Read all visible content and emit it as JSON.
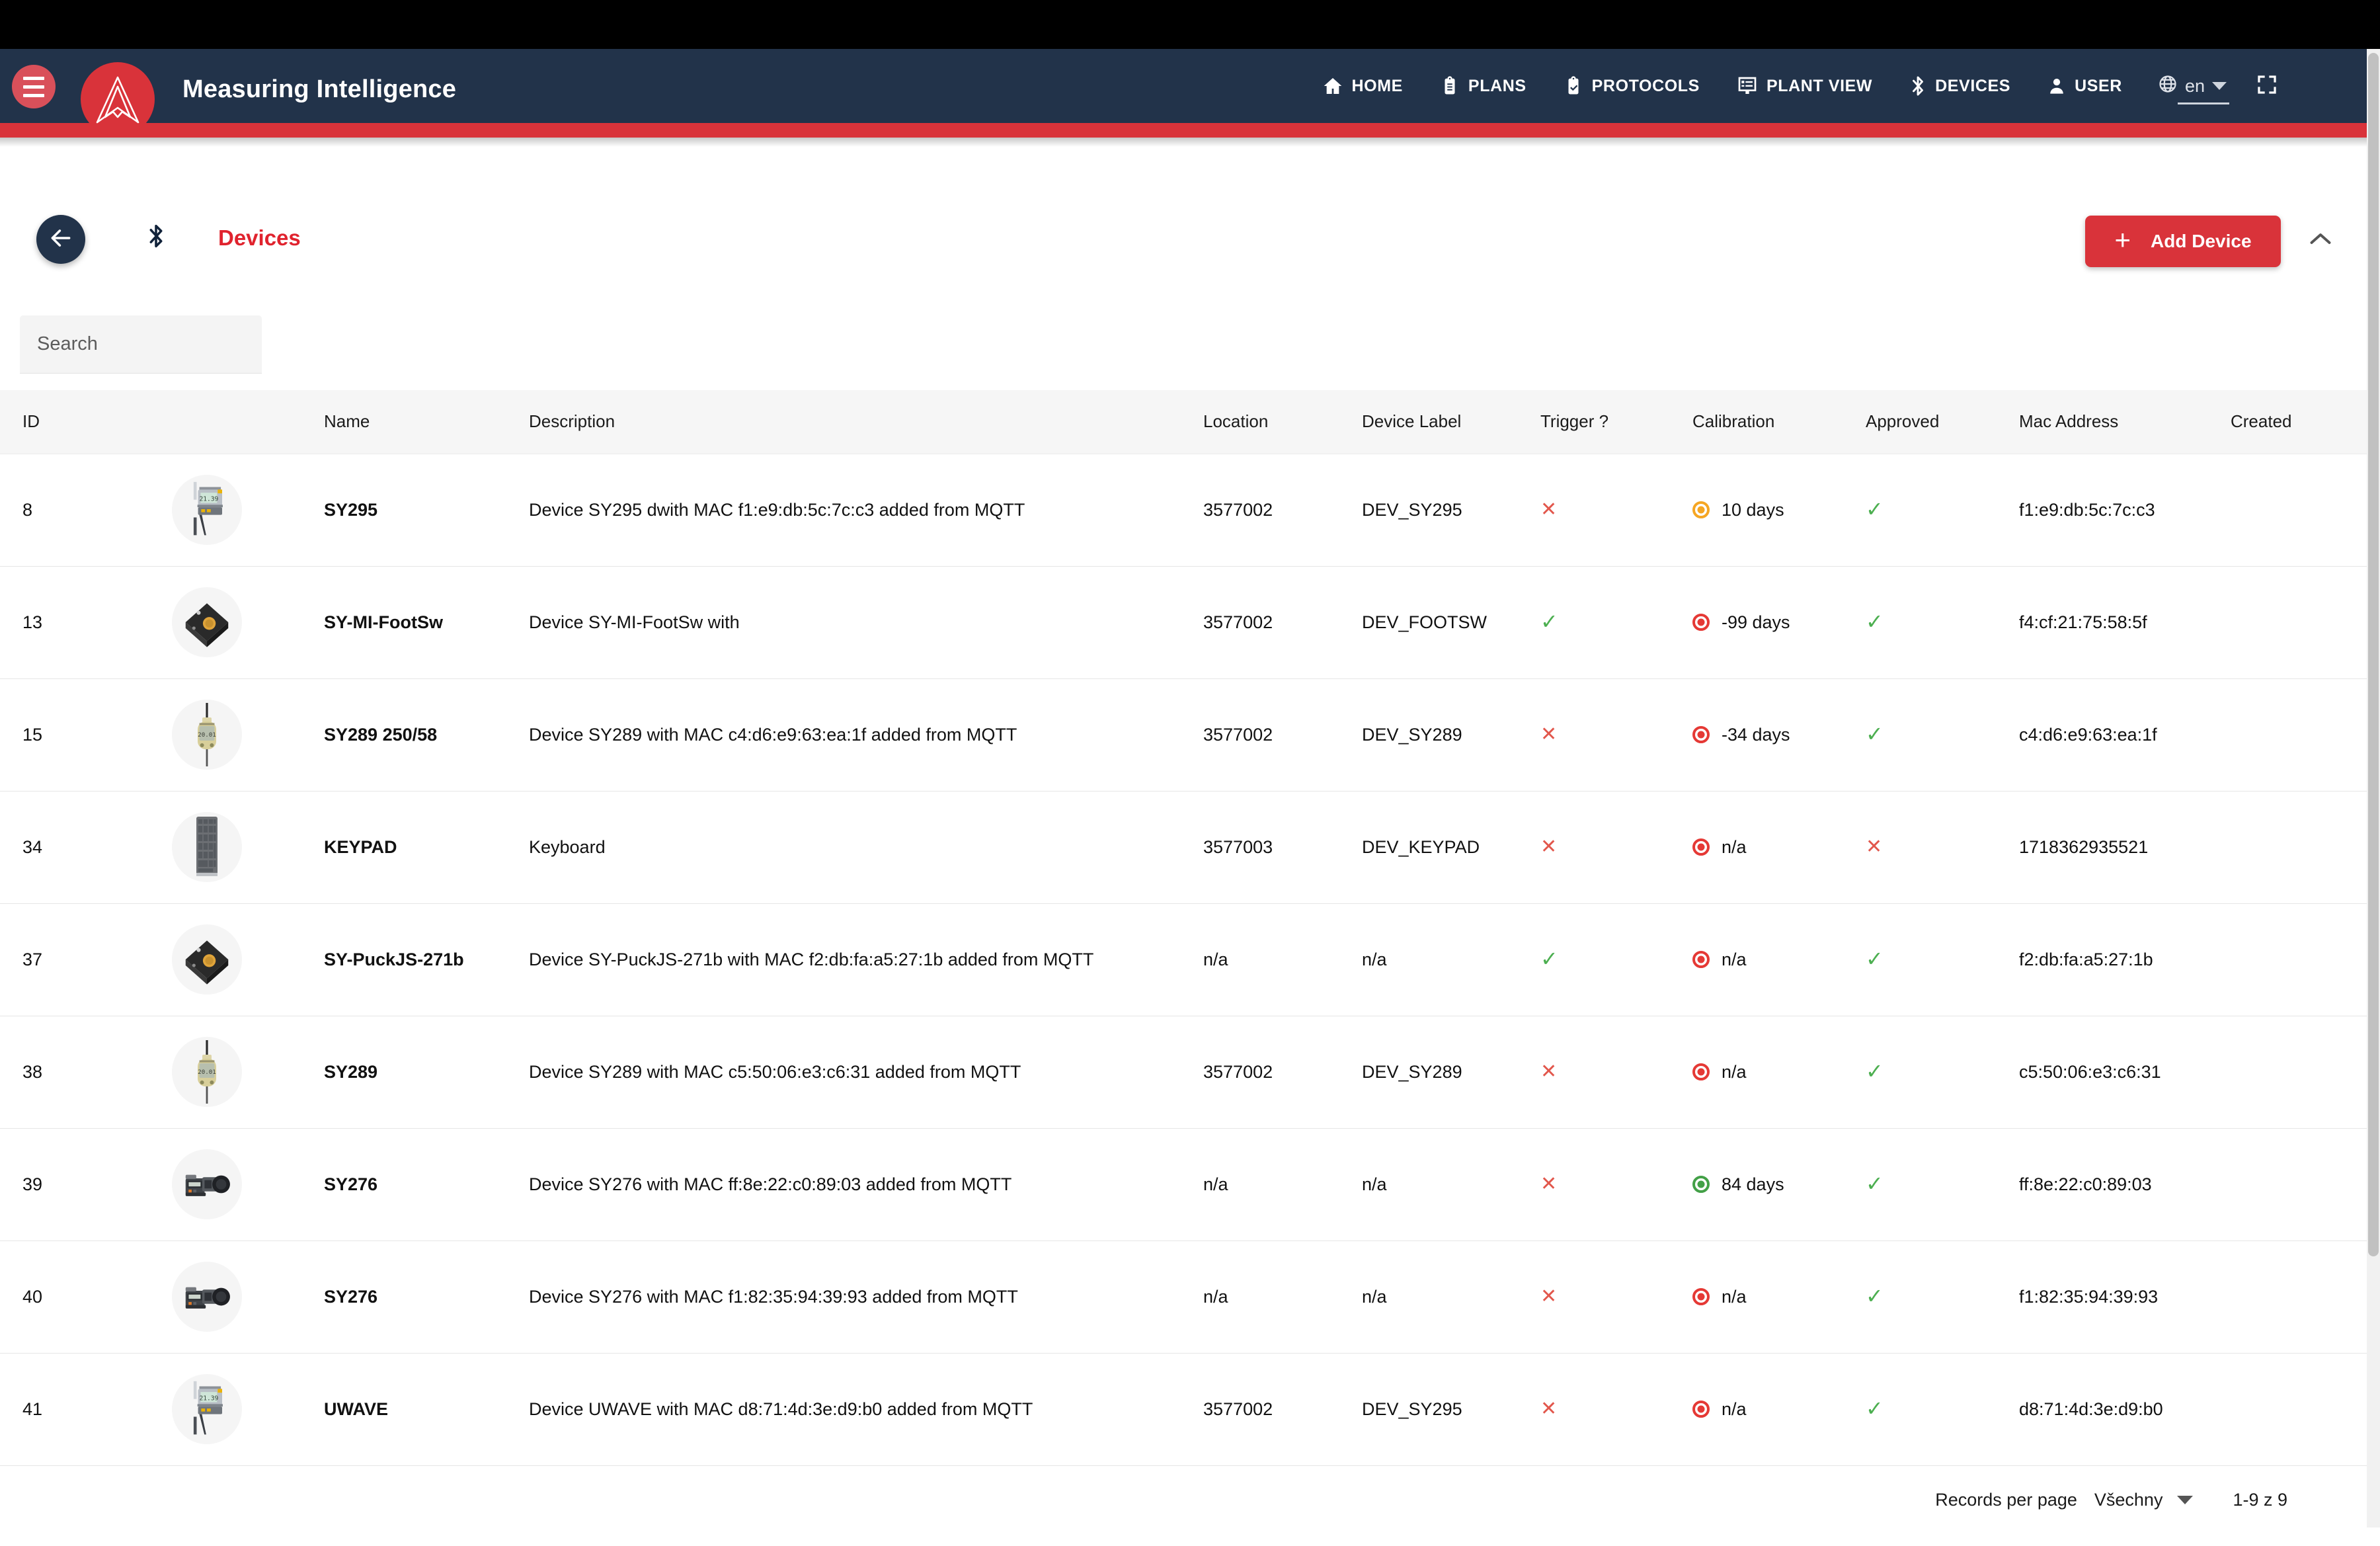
{
  "brand": {
    "title": "Measuring Intelligence",
    "logo_icon": "mountain-peak-logo",
    "menu_icon": "hamburger-menu-icon"
  },
  "nav": {
    "items": [
      {
        "label": "HOME",
        "icon": "home-icon"
      },
      {
        "label": "PLANS",
        "icon": "clipboard-icon"
      },
      {
        "label": "PROTOCOLS",
        "icon": "clipboard-check-icon"
      },
      {
        "label": "PLANT VIEW",
        "icon": "list-panel-icon"
      },
      {
        "label": "DEVICES",
        "icon": "bluetooth-icon"
      },
      {
        "label": "USER",
        "icon": "person-icon"
      }
    ],
    "language": {
      "value": "en",
      "icon": "globe-icon",
      "caret": "chevron-down-icon"
    },
    "fullscreen_icon": "fullscreen-icon"
  },
  "toolbar": {
    "back_icon": "arrow-left-icon",
    "bluetooth_icon": "bluetooth-icon",
    "title": "Devices",
    "add_button": {
      "label": "Add Device",
      "plus": "+",
      "color": "#d9333a"
    },
    "collapse_icon": "chevron-up-icon"
  },
  "search": {
    "placeholder": "Search",
    "value": ""
  },
  "table": {
    "columns": [
      "ID",
      "Name",
      "Description",
      "Location",
      "Device Label",
      "Trigger ?",
      "Calibration",
      "Approved",
      "Mac Address",
      "Created"
    ],
    "rows": [
      {
        "id": "8",
        "thumb": "caliper-icon",
        "name": "SY295",
        "description": "Device SY295 dwith MAC f1:e9:db:5c:7c:c3 added from MQTT",
        "location": "3577002",
        "device_label": "DEV_SY295",
        "trigger": "x",
        "calibration": "10 days",
        "calibration_status": "orange",
        "approved": "check",
        "mac": "f1:e9:db:5c:7c:c3",
        "created": ""
      },
      {
        "id": "13",
        "thumb": "puck-icon",
        "name": "SY-MI-FootSw",
        "description": "Device SY-MI-FootSw with",
        "location": "3577002",
        "device_label": "DEV_FOOTSW",
        "trigger": "check",
        "calibration": "-99 days",
        "calibration_status": "red",
        "approved": "check",
        "mac": "f4:cf:21:75:58:5f",
        "created": ""
      },
      {
        "id": "15",
        "thumb": "dial-gauge-icon",
        "name": "SY289 250/58",
        "description": "Device SY289 with MAC c4:d6:e9:63:ea:1f added from MQTT",
        "location": "3577002",
        "device_label": "DEV_SY289",
        "trigger": "x",
        "calibration": "-34 days",
        "calibration_status": "red",
        "approved": "check",
        "mac": "c4:d6:e9:63:ea:1f",
        "created": ""
      },
      {
        "id": "34",
        "thumb": "keypad-icon",
        "name": "KEYPAD",
        "description": "Keyboard",
        "location": "3577003",
        "device_label": "DEV_KEYPAD",
        "trigger": "x",
        "calibration": "n/a",
        "calibration_status": "red",
        "approved": "x",
        "mac": "1718362935521",
        "created": ""
      },
      {
        "id": "37",
        "thumb": "puck-icon",
        "name": "SY-PuckJS-271b",
        "description": "Device SY-PuckJS-271b with MAC f2:db:fa:a5:27:1b added from MQTT",
        "location": "n/a",
        "device_label": "n/a",
        "trigger": "check",
        "calibration": "n/a",
        "calibration_status": "red",
        "approved": "check",
        "mac": "f2:db:fa:a5:27:1b",
        "created": ""
      },
      {
        "id": "38",
        "thumb": "dial-gauge-icon",
        "name": "SY289",
        "description": "Device SY289 with MAC c5:50:06:e3:c6:31 added from MQTT",
        "location": "3577002",
        "device_label": "DEV_SY289",
        "trigger": "x",
        "calibration": "n/a",
        "calibration_status": "red",
        "approved": "check",
        "mac": "c5:50:06:e3:c6:31",
        "created": ""
      },
      {
        "id": "39",
        "thumb": "micrometer-icon",
        "name": "SY276",
        "description": "Device SY276 with MAC ff:8e:22:c0:89:03 added from MQTT",
        "location": "n/a",
        "device_label": "n/a",
        "trigger": "x",
        "calibration": "84 days",
        "calibration_status": "green",
        "approved": "check",
        "mac": "ff:8e:22:c0:89:03",
        "created": ""
      },
      {
        "id": "40",
        "thumb": "micrometer-icon",
        "name": "SY276",
        "description": "Device SY276 with MAC f1:82:35:94:39:93 added from MQTT",
        "location": "n/a",
        "device_label": "n/a",
        "trigger": "x",
        "calibration": "n/a",
        "calibration_status": "red",
        "approved": "check",
        "mac": "f1:82:35:94:39:93",
        "created": ""
      },
      {
        "id": "41",
        "thumb": "caliper-icon",
        "name": "UWAVE",
        "description": "Device UWAVE with MAC d8:71:4d:3e:d9:b0 added from MQTT",
        "location": "3577002",
        "device_label": "DEV_SY295",
        "trigger": "x",
        "calibration": "n/a",
        "calibration_status": "red",
        "approved": "check",
        "mac": "d8:71:4d:3e:d9:b0",
        "created": ""
      }
    ]
  },
  "footer": {
    "records_per_page_label": "Records per page",
    "records_per_page_value": "Všechny",
    "range": "1-9 z 9"
  },
  "colors": {
    "navbar": "#22334a",
    "accent_red": "#d9333a",
    "title_red": "#e0232e",
    "ok_green": "#4caf50",
    "error_red": "#e2574c"
  }
}
